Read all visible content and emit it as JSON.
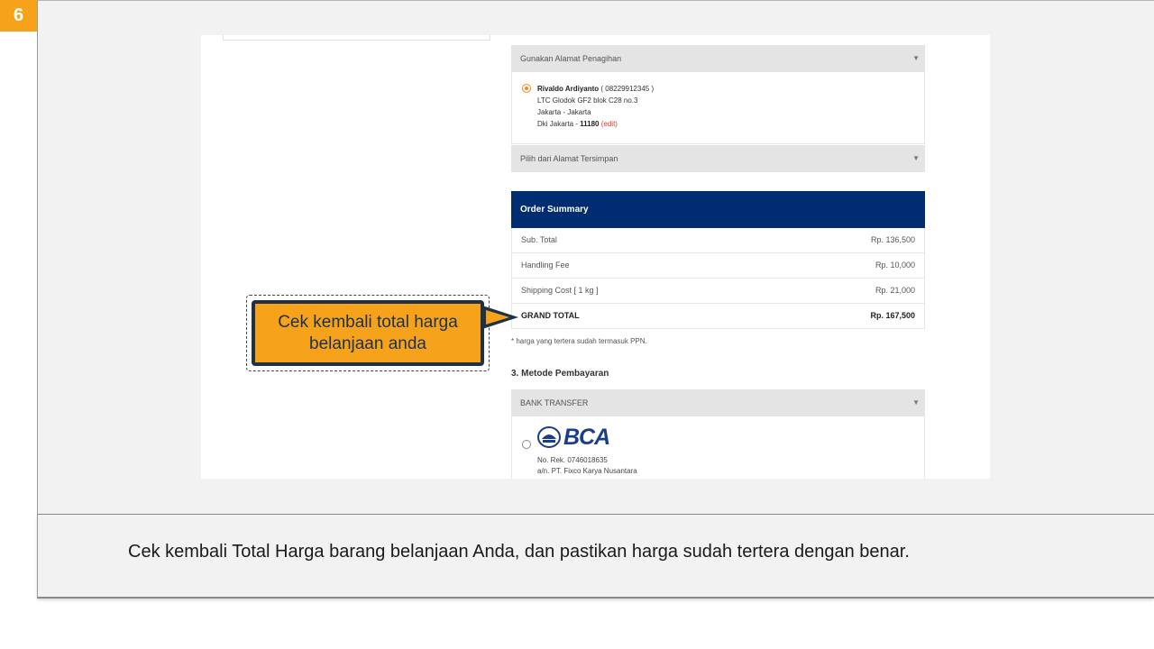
{
  "step_number": "6",
  "caption": "Cek kembali Total Harga barang belanjaan Anda, dan pastikan harga sudah tertera dengan benar.",
  "callout": {
    "line1": "Cek kembali total harga",
    "line2": "belanjaan anda"
  },
  "billing": {
    "dropdown_label": "Gunakan Alamat Penagihan",
    "saved_dropdown_label": "Pilih dari Alamat Tersimpan",
    "address": {
      "name": "Rivaldo Ardiyanto",
      "phone": "( 08229912345 )",
      "street": "LTC Glodok GF2 blok C28 no.3",
      "city": "Jakarta - Jakarta",
      "region": "Dki Jakarta - ",
      "postcode": "11180",
      "edit_label": "(edit)"
    }
  },
  "order_summary": {
    "title": "Order Summary",
    "rows": [
      {
        "label": "Sub. Total",
        "value": "Rp. 136,500"
      },
      {
        "label": "Handling Fee",
        "value": "Rp. 10,000"
      },
      {
        "label": "Shipping Cost [ 1 kg ]",
        "value": "Rp. 21,000"
      },
      {
        "label": "GRAND TOTAL",
        "value": "Rp. 167,500"
      }
    ],
    "note": "* harga yang tertera sudah termasuk PPN."
  },
  "payment": {
    "title": "3. Metode Pembayaran",
    "dropdown_label": "BANK TRANSFER",
    "bank": {
      "logo_text": "BCA",
      "account": "No. Rek. 0746018635",
      "holder": "a/n. PT. Fixco Karya Nusantara"
    }
  },
  "icons": {
    "caret": "▼"
  },
  "colors": {
    "accent_orange": "#f7a21b",
    "order_header_blue": "#002d72",
    "callout_border": "#1d3147",
    "edit_red": "#d9382d"
  }
}
